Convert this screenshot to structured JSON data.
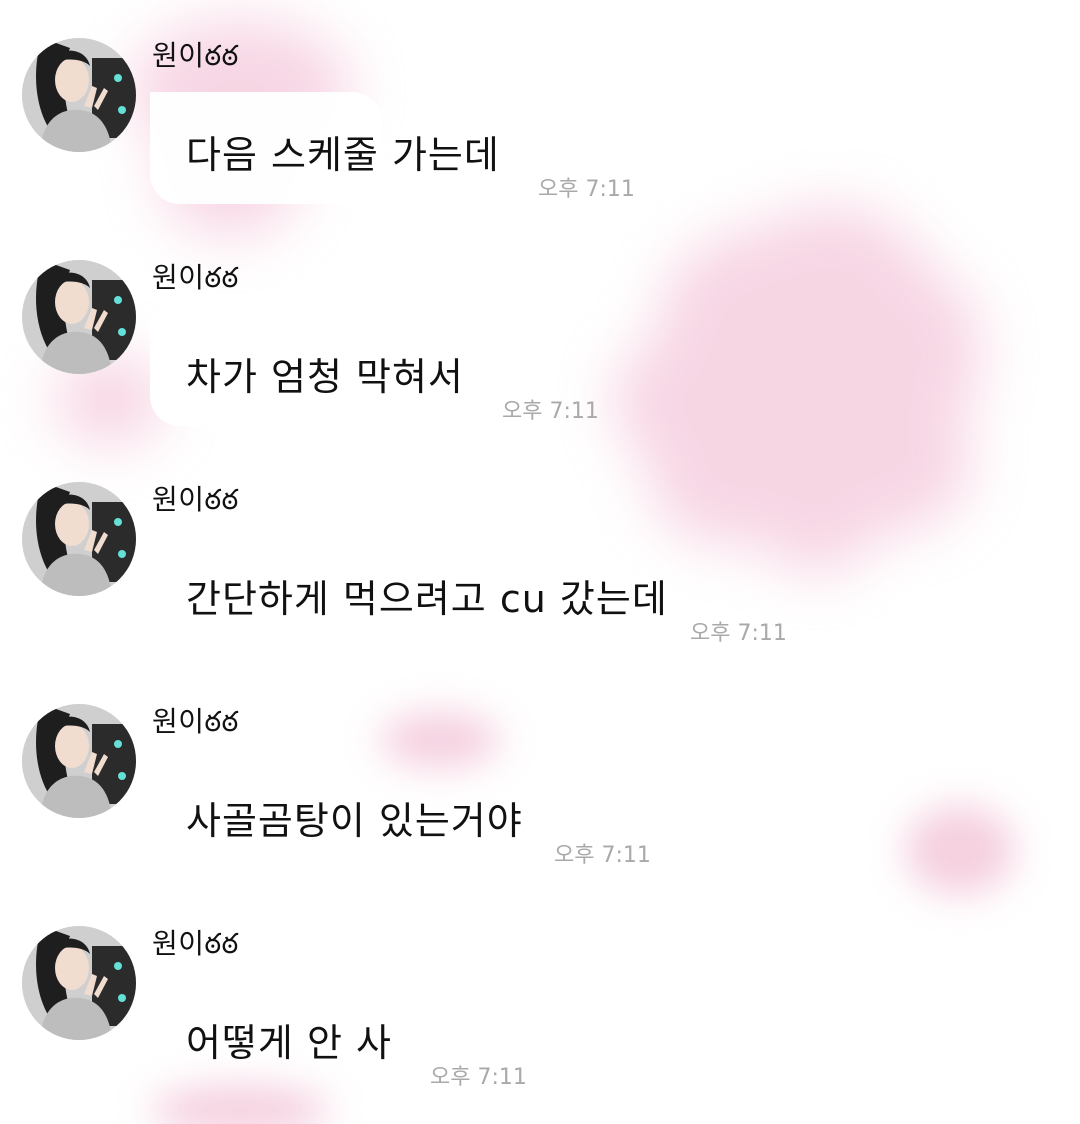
{
  "chat": {
    "messages": [
      {
        "sender": "원이ఠఠ",
        "text": "다음 스케줄 가는데",
        "time": "오후 7:11"
      },
      {
        "sender": "원이ఠఠ",
        "text": "차가 엄청 막혀서",
        "time": "오후 7:11"
      },
      {
        "sender": "원이ఠఠ",
        "text": "간단하게 먹으려고 cu 갔는데",
        "time": "오후 7:11"
      },
      {
        "sender": "원이ఠఠ",
        "text": "사골곰탕이 있는거야",
        "time": "오후 7:11"
      },
      {
        "sender": "원이ఠఠ",
        "text": "어떻게 안 사",
        "time": "오후 7:11"
      }
    ]
  },
  "theme": {
    "background": "#ffffff",
    "accent_blur": "#f3c9dc",
    "timestamp_color": "#a9a9a9",
    "avatar_icon": "profile-photo-icon"
  }
}
